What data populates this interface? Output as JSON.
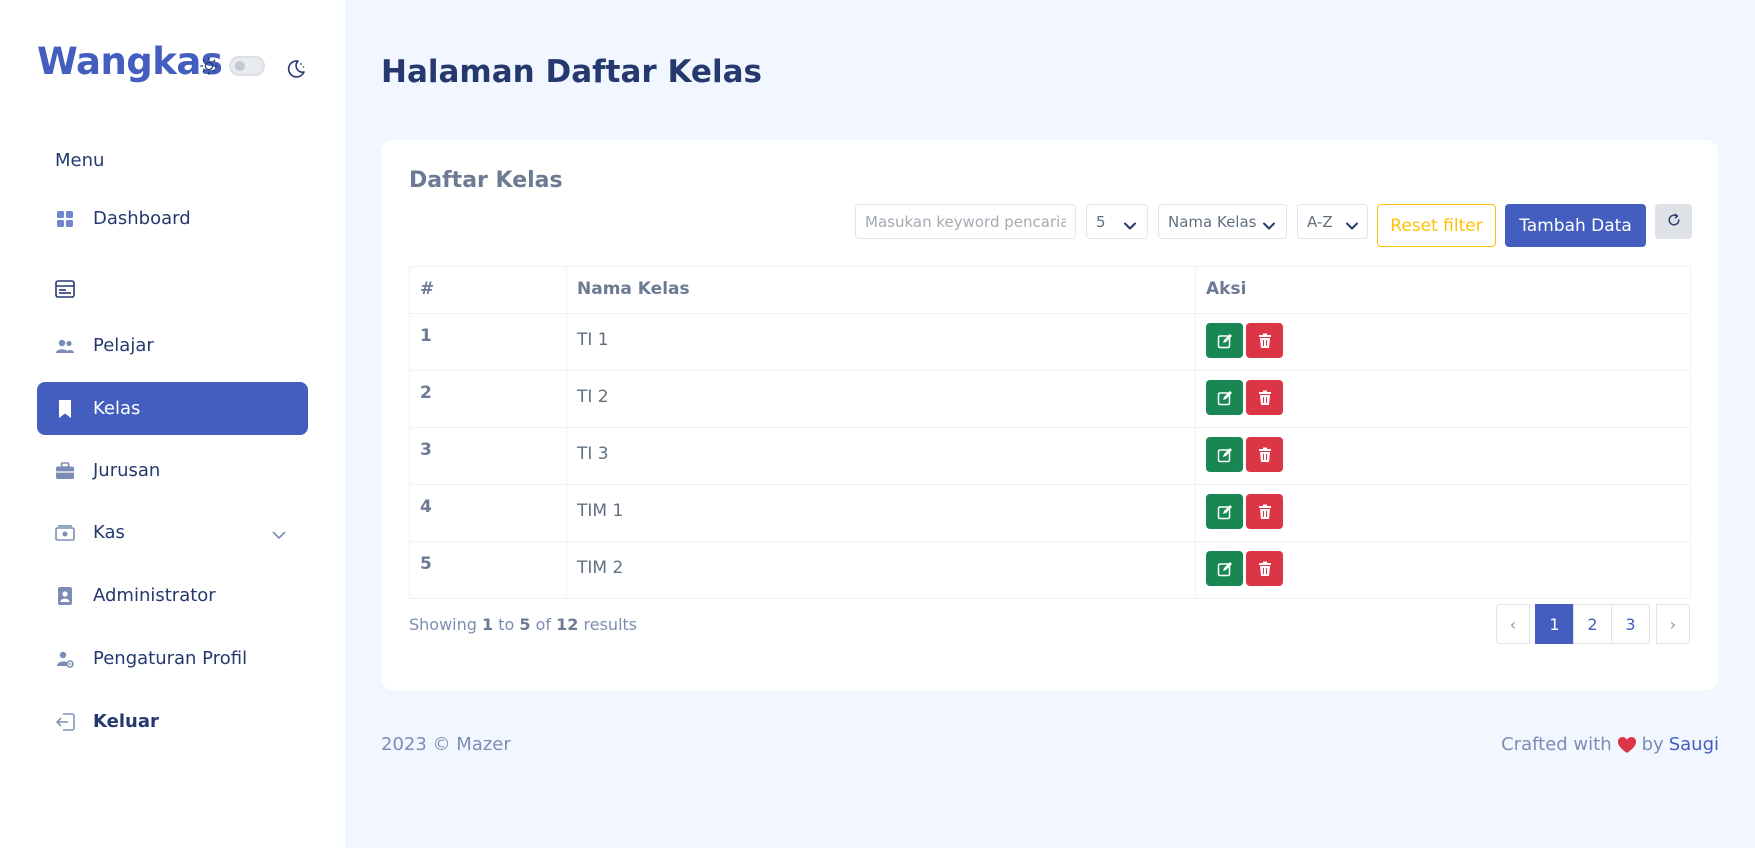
{
  "sidebar": {
    "brand": "Wangkas",
    "menu_title": "Menu",
    "items": [
      {
        "label": "Dashboard",
        "icon": "grid-icon"
      },
      {
        "label": "",
        "icon": "list-card-icon"
      },
      {
        "label": "Pelajar",
        "icon": "people-icon"
      },
      {
        "label": "Kelas",
        "icon": "bookmark-icon",
        "active": true
      },
      {
        "label": "Jurusan",
        "icon": "briefcase-icon"
      },
      {
        "label": "Kas",
        "icon": "cash-icon",
        "has_submenu": true
      },
      {
        "label": "Administrator",
        "icon": "id-badge-icon"
      },
      {
        "label": "Pengaturan Profil",
        "icon": "person-gear-icon"
      },
      {
        "label": "Keluar",
        "icon": "logout-icon"
      }
    ]
  },
  "page": {
    "title": "Halaman Daftar Kelas"
  },
  "card": {
    "title": "Daftar Kelas",
    "search_placeholder": "Masukan keyword pencarian",
    "per_page": "5",
    "sort_field": "Nama Kelas",
    "sort_order": "A-Z",
    "reset_label": "Reset filter",
    "add_label": "Tambah Data"
  },
  "table": {
    "headers": [
      "#",
      "Nama Kelas",
      "Aksi"
    ],
    "rows": [
      {
        "no": "1",
        "name": "TI 1"
      },
      {
        "no": "2",
        "name": "TI 2"
      },
      {
        "no": "3",
        "name": "TI 3"
      },
      {
        "no": "4",
        "name": "TIM 1"
      },
      {
        "no": "5",
        "name": "TIM 2"
      }
    ]
  },
  "pagination": {
    "showing_prefix": "Showing",
    "from": "1",
    "to_word": "to",
    "to": "5",
    "of_word": "of",
    "total": "12",
    "results_word": "results",
    "prev": "‹",
    "pages": [
      "1",
      "2",
      "3"
    ],
    "current": "1",
    "next": "›"
  },
  "footer": {
    "left": "2023 © Mazer",
    "crafted": "Crafted with",
    "by": "by",
    "author": "Saugi"
  },
  "colors": {
    "primary": "#435ebe",
    "success": "#198754",
    "danger": "#dc3545",
    "warning": "#ffc107"
  }
}
